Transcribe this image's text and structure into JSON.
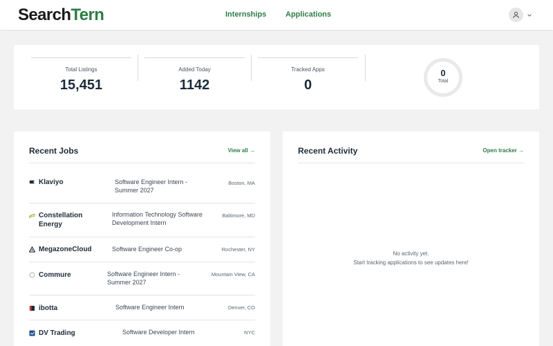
{
  "header": {
    "logo_main": "Search",
    "logo_accent": "Tern",
    "nav": [
      {
        "label": "Internships"
      },
      {
        "label": "Applications"
      }
    ]
  },
  "stats": {
    "items": [
      {
        "label": "Total Listings",
        "value": "15,451"
      },
      {
        "label": "Added Today",
        "value": "1142"
      },
      {
        "label": "Tracked Apps",
        "value": "0"
      }
    ],
    "ring": {
      "value": "0",
      "label": "Total"
    }
  },
  "recent_jobs": {
    "title": "Recent Jobs",
    "link": "View all →",
    "jobs": [
      {
        "company": "Klaviyo",
        "role": "Software Engineer Intern - Summer 2027",
        "location": "Boston, MA",
        "icon": "klaviyo-flag-icon",
        "icon_color": "#1c2b3a"
      },
      {
        "company": "Constellation Energy",
        "role": "Information Technology Software Development Intern",
        "location": "Baltimore, MD",
        "icon": "constellation-swoosh-icon",
        "icon_color": "#c9a227"
      },
      {
        "company": "MegazoneCloud",
        "role": "Software Engineer Co-op",
        "location": "Rochester, NY",
        "icon": "megazone-triangle-icon",
        "icon_color": "#1c2b3a"
      },
      {
        "company": "Commure",
        "role": "Software Engineer Intern - Summer 2027",
        "location": "Mountain View, CA",
        "icon": "commure-circle-icon",
        "icon_color": "#b5b5b5"
      },
      {
        "company": "ibotta",
        "role": "Software Engineer Intern",
        "location": "Denver, CO",
        "icon": "ibotta-square-icon",
        "icon_color": "#c0392b"
      },
      {
        "company": "DV Trading",
        "role": "Software Developer Intern",
        "location": "NYC",
        "icon": "dv-trading-chart-icon",
        "icon_color": "#1f4e8c"
      }
    ]
  },
  "recent_activity": {
    "title": "Recent Activity",
    "link": "Open tracker →",
    "empty_line1": "No activity yet.",
    "empty_line2": "Start tracking applications to see updates here!"
  },
  "colors": {
    "brand_green": "#2e7d45",
    "text_dark": "#1c2b3a",
    "background": "#f2f2f2"
  }
}
